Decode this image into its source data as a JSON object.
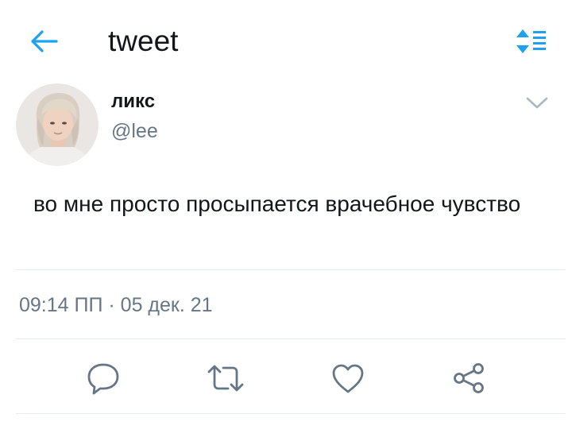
{
  "header": {
    "title": "tweet",
    "back_icon": "arrow-left-icon",
    "sort_icon": "sort-list-icon",
    "accent_color": "#1da1f2"
  },
  "tweet": {
    "author": {
      "display_name": "ликс",
      "handle": "@lee",
      "avatar_icon": "avatar-photo"
    },
    "text": "во мне просто просыпается врачебное чувство",
    "timestamp": "09:14 ПП · 05 дек. 21",
    "more_icon": "chevron-down-icon"
  },
  "actions": [
    {
      "name": "reply",
      "icon": "speech-bubble-icon"
    },
    {
      "name": "retweet",
      "icon": "retweet-icon"
    },
    {
      "name": "like",
      "icon": "heart-icon"
    },
    {
      "name": "share",
      "icon": "share-icon"
    }
  ],
  "colors": {
    "text_primary": "#14171a",
    "text_secondary": "#657786",
    "divider": "#e6ecf0",
    "icon_gray": "#657786",
    "accent": "#1da1f2"
  }
}
